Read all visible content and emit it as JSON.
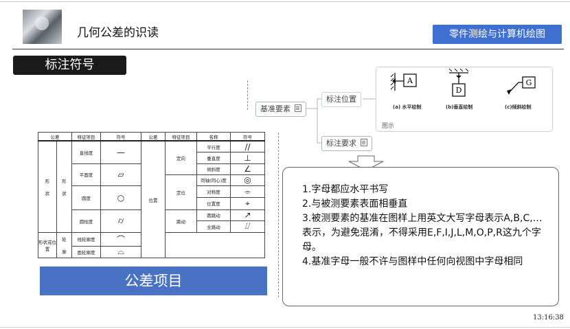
{
  "header": {
    "title": "几何公差的识读",
    "course_button": "零件测绘与计算机绘图"
  },
  "section_label": "标注符号",
  "table": {
    "headers": [
      "公差",
      "特征项目",
      "符号",
      "公差",
      "特征项目",
      "名称",
      "符号"
    ],
    "left_groups": {
      "g1": "形",
      "g2": "状",
      "g3": "形",
      "g4": "状",
      "g5": "形状或位置",
      "g6": "轮",
      "g7": "廓"
    },
    "left_rows": [
      {
        "item": "直线度",
        "sym": "—"
      },
      {
        "item": "平面度",
        "sym": "▱"
      },
      {
        "item": "圆度",
        "sym": "○"
      },
      {
        "item": "圆柱度",
        "sym": "⌭"
      },
      {
        "item": "线轮廓度",
        "sym": "⌒"
      },
      {
        "item": "面轮廓度",
        "sym": "⌓"
      }
    ],
    "right_group": "位置",
    "right_subgroups": {
      "a": "定向",
      "b": "定位",
      "c": "跳动"
    },
    "right_rows": [
      {
        "name": "平行度",
        "sym": "//"
      },
      {
        "name": "垂直度",
        "sym": "⊥"
      },
      {
        "name": "倾斜度",
        "sym": "∠"
      },
      {
        "name": "同轴(同心)度",
        "sym": "◎"
      },
      {
        "name": "对称度",
        "sym": "⌯"
      },
      {
        "name": "位置度",
        "sym": "⌖"
      },
      {
        "name": "圆跳动",
        "sym": "↗"
      },
      {
        "name": "全跳动",
        "sym": "⌰"
      }
    ]
  },
  "big_button": "公差项目",
  "mindmap": {
    "root": "基准要素",
    "child1": "标注位置",
    "child2": "标注要求"
  },
  "figure": {
    "letters": [
      "A",
      "D",
      "G"
    ],
    "captions": [
      "(a) 水平绘制",
      "(b)垂直绘制",
      "(c)倾斜绘制"
    ],
    "title": "图示"
  },
  "notes": [
    "1.字母都应水平书写",
    "2.与被测要素表面相垂直",
    "3.被测要素的基准在图样上用英文大写字母表示A,B,C,…表示，为避免混淆，不得采用E,F,I,J,L,M,O,P,R这九个字母。",
    "4.基准字母一般不许与图样中任何向视图中字母相同"
  ],
  "clock": "13:16:38"
}
